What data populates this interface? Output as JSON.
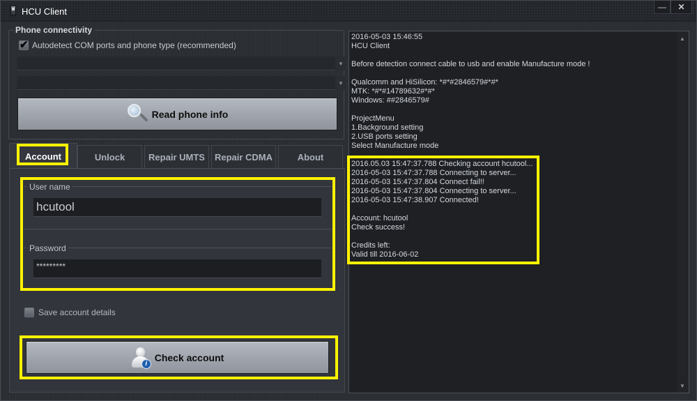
{
  "window": {
    "title": "HCU Client",
    "minimize_label": "—",
    "close_label": "✕"
  },
  "phone_connectivity": {
    "title": "Phone connectivity",
    "autodetect_label": "Autodetect COM ports and phone type (recommended)",
    "autodetect_checked": true,
    "combo1_value": "",
    "combo2_value": "",
    "combo_arrow": "▼",
    "read_button_label": "Read phone info"
  },
  "tabs": [
    {
      "label": "Account",
      "active": true
    },
    {
      "label": "Unlock",
      "active": false
    },
    {
      "label": "Repair UMTS",
      "active": false
    },
    {
      "label": "Repair CDMA",
      "active": false
    },
    {
      "label": "About",
      "active": false
    }
  ],
  "account": {
    "username_label": "User name",
    "username_value": "hcutool",
    "password_label": "Password",
    "password_value": "*********",
    "save_label": "Save account details",
    "save_checked": false,
    "check_button_label": "Check account"
  },
  "log": {
    "lines": [
      "2016-05-03 15:46:55",
      "HCU Client",
      "",
      "Before detection connect cable to usb and enable Manufacture mode !",
      "",
      "Qualcomm and HiSilicon: *#*#2846579#*#*",
      "MTK: *#*#14789632#*#*",
      "Windows: ##2846579#",
      "",
      "ProjectMenu",
      "1.Background setting",
      "2.USB ports setting",
      "Select Manufacture mode",
      "",
      "2016.05.03 15:47:37.788 Checking account hcutool...",
      "2016-05-03 15:47:37.788 Connecting to server...",
      "2016-05-03 15:47:37.804 Connect fail!!",
      "2016-05-03 15:47:37.804 Connecting to server...",
      "2016-05-03 15:47:38.907 Connected!",
      "",
      "Account: hcutool",
      "Check success!",
      "",
      "Credits left:",
      "Valid till 2016-06-02"
    ],
    "scroll_up": "▲",
    "scroll_down": "▼"
  },
  "colors": {
    "highlight": "#fff200",
    "background": "#2b2e33",
    "log_background": "#1e2024",
    "button_face": "#a3a8b0"
  }
}
